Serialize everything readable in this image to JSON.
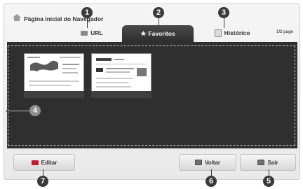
{
  "header": {
    "title": "Página inicial do Navegador",
    "page_indicator": "1/2 page"
  },
  "tabs": [
    {
      "label": "URL",
      "icon": "url-icon"
    },
    {
      "label": "Favoritos",
      "icon": "star-icon",
      "active": true
    },
    {
      "label": "Histórico",
      "icon": "history-icon"
    }
  ],
  "buttons": {
    "edit": "Editar",
    "back": "Voltar",
    "exit": "Sair"
  },
  "callouts": [
    "1",
    "2",
    "3",
    "4",
    "5",
    "6",
    "7"
  ],
  "colors": {
    "active_tab": "#2d2d2d",
    "content_bg": "#2f2f2f",
    "edit_key": "#c01c2c"
  }
}
